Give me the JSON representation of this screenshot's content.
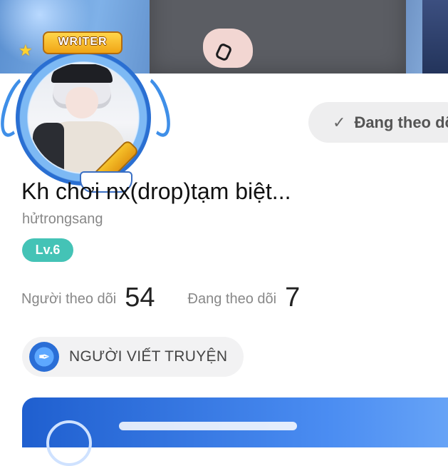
{
  "profile": {
    "badge": "WRITER",
    "display_name": "Kh chơi nx(drop)tạm biệt...",
    "username": "hửtrongsang",
    "level": "Lv.6"
  },
  "follow_button": {
    "label": "Đang theo dõi",
    "icon": "check-icon"
  },
  "stats": {
    "followers_label": "Người theo dõi",
    "followers_count": "54",
    "following_label": "Đang theo dõi",
    "following_count": "7"
  },
  "role_chip": {
    "label": "NGƯỜI VIẾT TRUYỆN",
    "icon": "pen-nib-icon"
  },
  "colors": {
    "level_badge": "#44c3b6",
    "accent_blue": "#2a6ed6",
    "chip_bg": "#f2f2f3"
  }
}
